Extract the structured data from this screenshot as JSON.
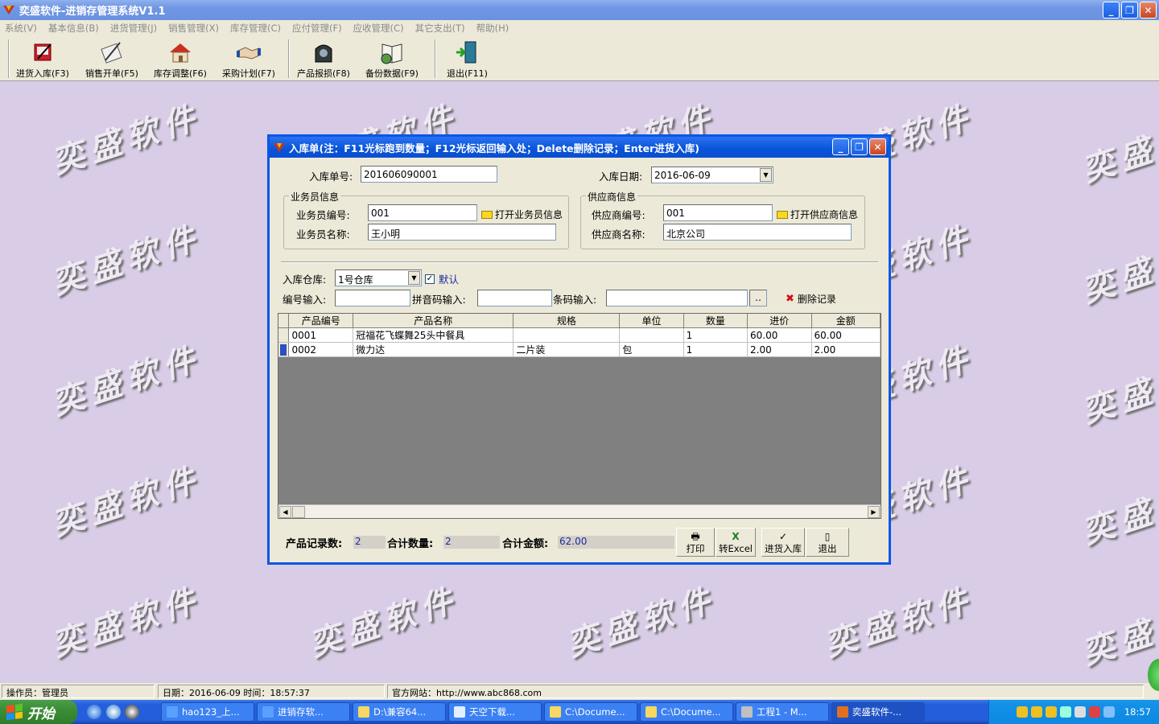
{
  "window": {
    "title": "奕盛软件-进销存管理系统V1.1",
    "minimize": "_",
    "restore": "❐",
    "close": "✕"
  },
  "menu": [
    "系统(V)",
    "基本信息(B)",
    "进货管理(J)",
    "销售管理(X)",
    "库存管理(C)",
    "应付管理(F)",
    "应收管理(C)",
    "其它支出(T)",
    "帮助(H)"
  ],
  "toolbar": {
    "purchase_in": "进货入库(F3)",
    "sales_order": "销售开单(F5)",
    "stock_adjust": "库存调整(F6)",
    "purchase_plan": "采购计划(F7)",
    "product_loss": "产品报损(F8)",
    "backup": "备份数据(F9)",
    "exit": "退出(F11)"
  },
  "watermark": "奕盛软件",
  "dialog": {
    "title": "入库单(注：F11光标跑到数量；F12光标返回输入处；Delete删除记录；Enter进货入库)",
    "order_no_label": "入库单号:",
    "order_no": "201606090001",
    "date_label": "入库日期:",
    "date": "2016-06-09",
    "salesperson_group": "业务员信息",
    "salesperson_no_label": "业务员编号:",
    "salesperson_no": "001",
    "open_salesperson": "打开业务员信息",
    "salesperson_name_label": "业务员名称:",
    "salesperson_name": "王小明",
    "supplier_group": "供应商信息",
    "supplier_no_label": "供应商编号:",
    "supplier_no": "001",
    "open_supplier": "打开供应商信息",
    "supplier_name_label": "供应商名称:",
    "supplier_name": "北京公司",
    "warehouse_label": "入库仓库:",
    "warehouse": "1号仓库",
    "default_label": "默认",
    "code_input_label": "编号输入:",
    "pinyin_input_label": "拼音码输入:",
    "barcode_input_label": "条码输入:",
    "browse": "‥",
    "delete_record": "删除记录",
    "columns": [
      "产品编号",
      "产品名称",
      "规格",
      "单位",
      "数量",
      "进价",
      "金额"
    ],
    "rows": [
      [
        "0001",
        "冠福花飞蝶舞25头中餐具",
        "",
        "",
        "1",
        "60.00",
        "60.00"
      ],
      [
        "0002",
        "微力达",
        "二片装",
        "包",
        "1",
        "2.00",
        "2.00"
      ]
    ],
    "record_count_label": "产品记录数:",
    "record_count": "2",
    "total_qty_label": "合计数量:",
    "total_qty": "2",
    "total_amount_label": "合计金额:",
    "total_amount": "62.00",
    "print": "打印",
    "to_excel": "转Excel",
    "stock_in": "进货入库",
    "exit": "退出"
  },
  "status": {
    "operator": "操作员：管理员",
    "datetime": "日期：2016-06-09  时间：18:57:37",
    "website": "官方网站：http://www.abc868.com"
  },
  "taskbar": {
    "start": "开始",
    "tasks": [
      "hao123_上...",
      "进销存软...",
      "D:\\兼容64...",
      "天空下载...",
      "C:\\Docume...",
      "C:\\Docume...",
      "工程1 - M...",
      "奕盛软件-..."
    ],
    "clock": "18:57"
  }
}
